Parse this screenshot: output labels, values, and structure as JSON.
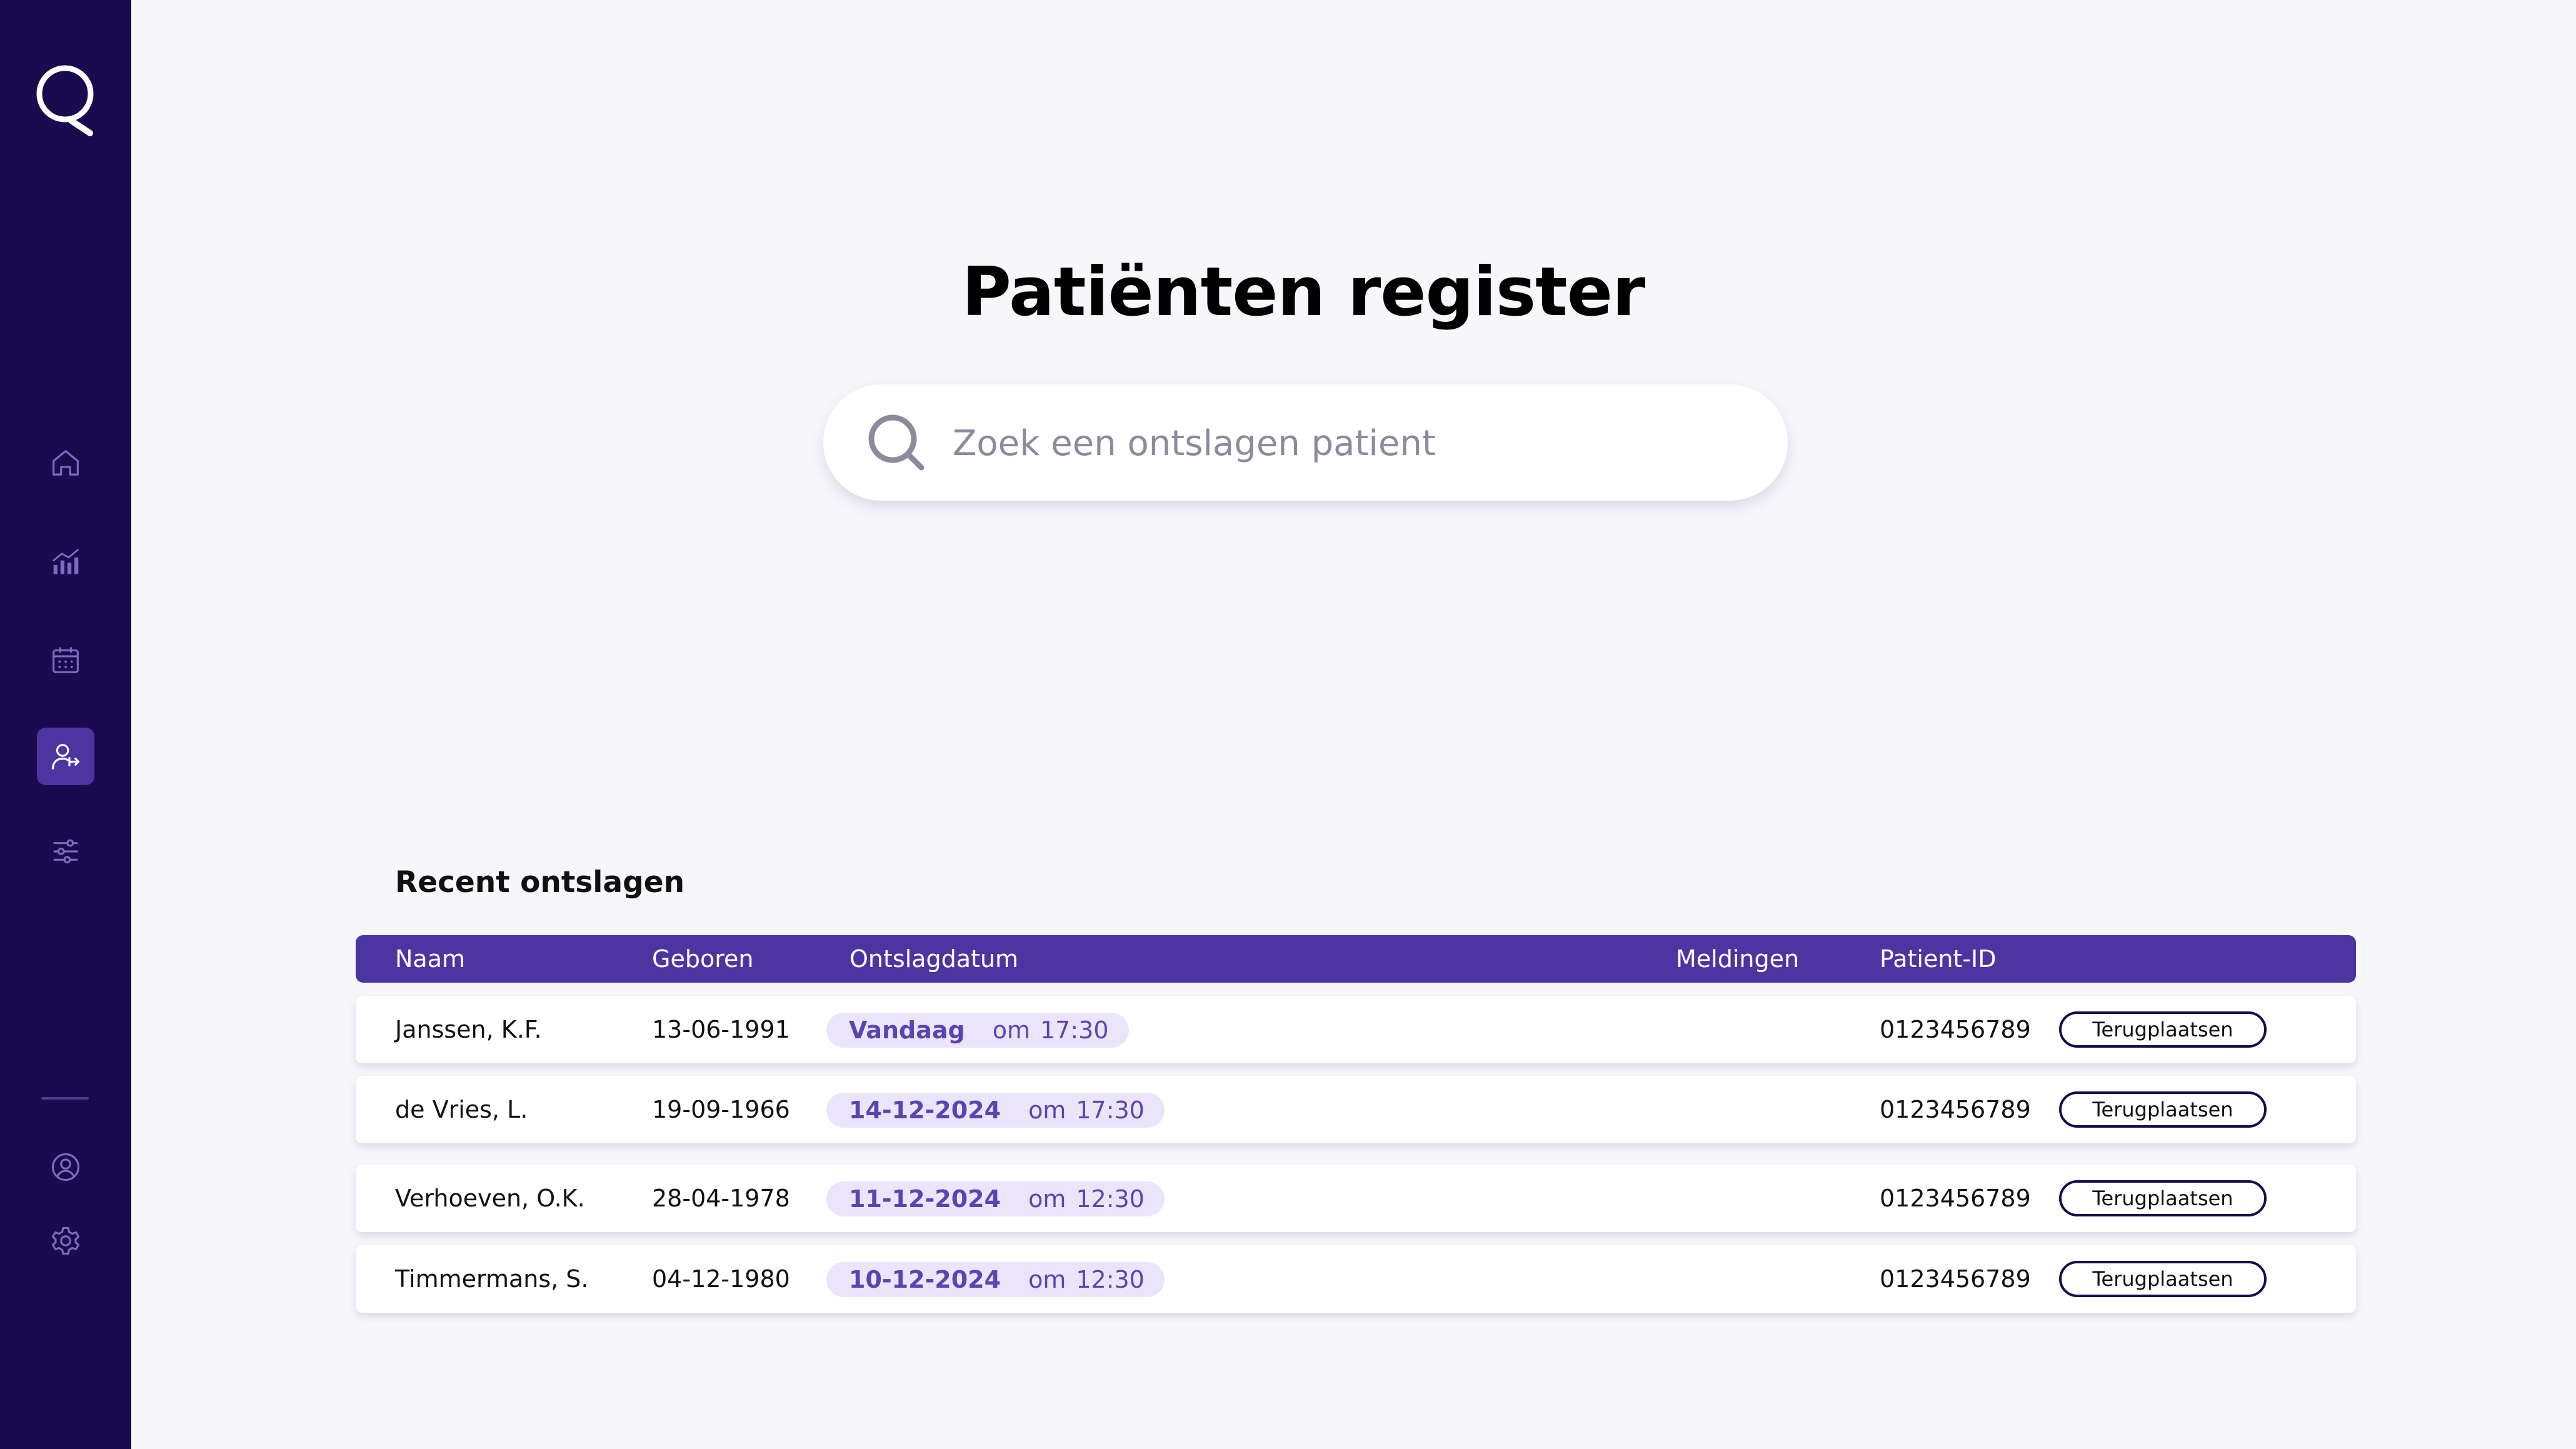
{
  "page": {
    "title": "Patiënten register"
  },
  "search": {
    "placeholder": "Zoek een ontslagen patient",
    "value": ""
  },
  "sidebar": {
    "logo_icon": "q-logo-icon",
    "nav": [
      {
        "icon": "home-icon",
        "active": false
      },
      {
        "icon": "chart-icon",
        "active": false
      },
      {
        "icon": "calendar-icon",
        "active": false
      },
      {
        "icon": "user-discharge-icon",
        "active": true
      },
      {
        "icon": "sliders-icon",
        "active": false
      }
    ],
    "bottom": [
      {
        "icon": "account-icon"
      },
      {
        "icon": "settings-icon"
      }
    ]
  },
  "recent": {
    "title": "Recent ontslagen",
    "columns": {
      "name": "Naam",
      "born": "Geboren",
      "discharge": "Ontslagdatum",
      "alerts": "Meldingen",
      "patient_id": "Patient-ID"
    },
    "rows": [
      {
        "name": "Janssen, K.F.",
        "born": "13-06-1991",
        "date": "Vandaag",
        "om": "om",
        "time": "17:30",
        "patient_id": "0123456789",
        "action": "Terugplaatsen"
      },
      {
        "name": "de Vries, L.",
        "born": "19-09-1966",
        "date": "14-12-2024",
        "om": "om",
        "time": "17:30",
        "patient_id": "0123456789",
        "action": "Terugplaatsen"
      },
      {
        "name": "Verhoeven, O.K.",
        "born": "28-04-1978",
        "date": "11-12-2024",
        "om": "om",
        "time": "12:30",
        "patient_id": "0123456789",
        "action": "Terugplaatsen"
      },
      {
        "name": "Timmermans, S.",
        "born": "04-12-1980",
        "date": "10-12-2024",
        "om": "om",
        "time": "12:30",
        "patient_id": "0123456789",
        "action": "Terugplaatsen"
      }
    ]
  },
  "colors": {
    "sidebar_bg": "#1a0b4f",
    "accent": "#4c35a0",
    "pill_bg": "#ebe5fb",
    "pill_text": "#5a45b0",
    "page_bg": "#f7f6fb"
  }
}
